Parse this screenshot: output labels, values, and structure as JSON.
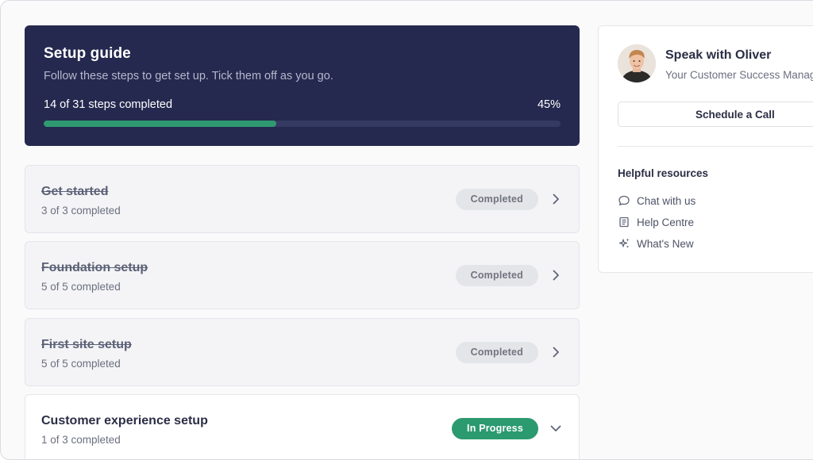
{
  "hero": {
    "title": "Setup guide",
    "subtitle": "Follow these steps to get set up. Tick them off as you go.",
    "steps_text": "14 of 31 steps completed",
    "percent_text": "45%",
    "progress": 0.45,
    "colors": {
      "background": "#25294f",
      "fill": "#2f9a71"
    }
  },
  "sections": [
    {
      "title": "Get started",
      "meta": "3 of 3 completed",
      "status": "Completed",
      "state": "done"
    },
    {
      "title": "Foundation setup",
      "meta": "5 of 5 completed",
      "status": "Completed",
      "state": "done"
    },
    {
      "title": "First site setup",
      "meta": "5 of 5 completed",
      "status": "Completed",
      "state": "done"
    },
    {
      "title": "Customer experience setup",
      "meta": "1 of 3 completed",
      "status": "In Progress",
      "state": "active"
    }
  ],
  "side": {
    "name": "Speak with Oliver",
    "role": "Your Customer Success Manager",
    "call_label": "Schedule a Call",
    "resources_title": "Helpful resources",
    "resources": [
      {
        "label": "Chat with us",
        "icon": "chat-bubble-icon"
      },
      {
        "label": "Help Centre",
        "icon": "book-icon"
      },
      {
        "label": "What's New",
        "icon": "sparkle-icon"
      }
    ]
  }
}
